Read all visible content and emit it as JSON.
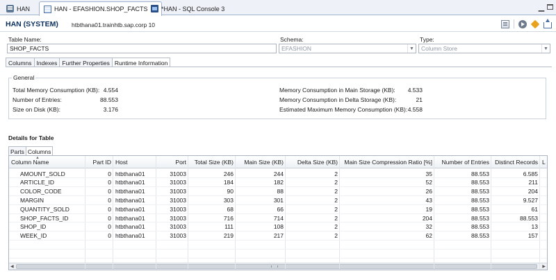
{
  "editor_tabs": [
    {
      "label": "HAN",
      "icon": "database-icon"
    },
    {
      "label": "HAN - EFASHION.SHOP_FACTS",
      "icon": "table-icon"
    },
    {
      "label": "*HAN - SQL Console 3",
      "icon": "sql-console-icon"
    }
  ],
  "tab_close": "×",
  "header": {
    "title": "HAN (SYSTEM)",
    "host": "htbthana01.trainhtb.sap.corp 10"
  },
  "form": {
    "table_name_label": "Table Name:",
    "table_name_value": "SHOP_FACTS",
    "schema_label": "Schema:",
    "schema_value": "EFASHION",
    "type_label": "Type:",
    "type_value": "Column Store"
  },
  "subtabs": [
    "Columns",
    "Indexes",
    "Further Properties",
    "Runtime Information"
  ],
  "general": {
    "title": "General",
    "left": [
      {
        "label": "Total Memory Consumption (KB):",
        "value": "4.554"
      },
      {
        "label": "Number of Entries:",
        "value": "88.553"
      },
      {
        "label": "Size on Disk (KB):",
        "value": "3.176"
      }
    ],
    "right": [
      {
        "label": "Memory Consumption in Main Storage (KB):",
        "value": "4.533"
      },
      {
        "label": "Memory Consumption in Delta Storage (KB):",
        "value": "21"
      },
      {
        "label": "Estimated Maximum Memory Consumption (KB):",
        "value": "4.558"
      }
    ]
  },
  "details_title": "Details for Table",
  "detail_tabs": [
    "Parts",
    "Columns"
  ],
  "grid": {
    "columns": [
      "Column Name",
      "Part ID",
      "Host",
      "Port",
      "Total Size (KB)",
      "Main Size (KB)",
      "Delta Size (KB)",
      "Main Size Compression Ratio [%]",
      "Number of Entries",
      "Distinct Records",
      "L"
    ],
    "rows": [
      [
        "AMOUNT_SOLD",
        "0",
        "htbthana01",
        "31003",
        "246",
        "244",
        "2",
        "35",
        "88.553",
        "6.585"
      ],
      [
        "ARTICLE_ID",
        "0",
        "htbthana01",
        "31003",
        "184",
        "182",
        "2",
        "52",
        "88.553",
        "211"
      ],
      [
        "COLOR_CODE",
        "0",
        "htbthana01",
        "31003",
        "90",
        "88",
        "2",
        "26",
        "88.553",
        "204"
      ],
      [
        "MARGIN",
        "0",
        "htbthana01",
        "31003",
        "303",
        "301",
        "2",
        "43",
        "88.553",
        "9.527"
      ],
      [
        "QUANTITY_SOLD",
        "0",
        "htbthana01",
        "31003",
        "68",
        "66",
        "2",
        "19",
        "88.553",
        "61"
      ],
      [
        "SHOP_FACTS_ID",
        "0",
        "htbthana01",
        "31003",
        "716",
        "714",
        "2",
        "204",
        "88.553",
        "88.553"
      ],
      [
        "SHOP_ID",
        "0",
        "htbthana01",
        "31003",
        "111",
        "108",
        "2",
        "32",
        "88.553",
        "13"
      ],
      [
        "WEEK_ID",
        "0",
        "htbthana01",
        "31003",
        "219",
        "217",
        "2",
        "62",
        "88.553",
        "157"
      ]
    ]
  }
}
